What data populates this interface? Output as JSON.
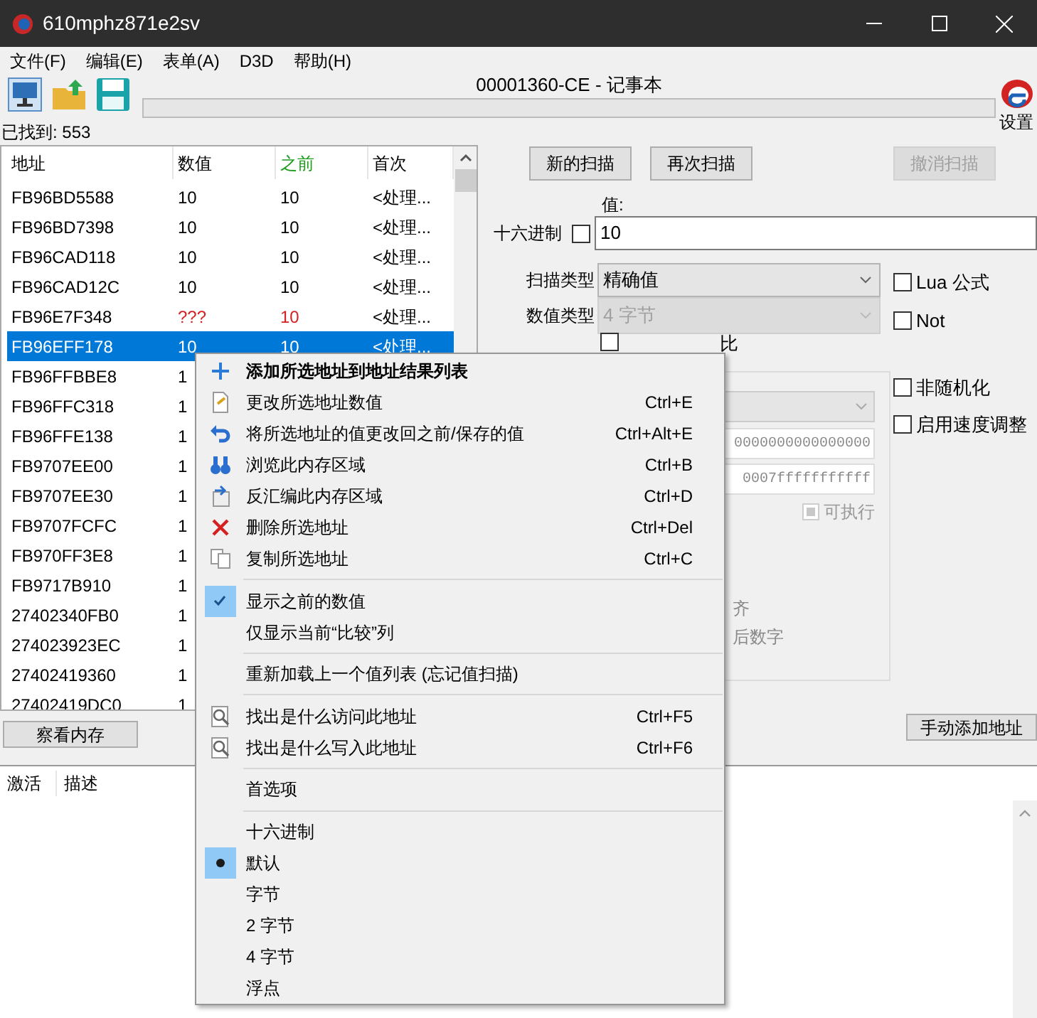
{
  "window": {
    "title": "610mphz871e2sv"
  },
  "menu_bar": [
    "文件(F)",
    "编辑(E)",
    "表单(A)",
    "D3D",
    "帮助(H)"
  ],
  "process_title": "00001360-CE - 记事本",
  "found_label": "已找到: 553",
  "progress": {
    "level": 0
  },
  "settings_label": "设置",
  "results": {
    "columns": [
      {
        "label": "地址"
      },
      {
        "label": "数值"
      },
      {
        "label": "之前",
        "color": "#1e9e1e"
      },
      {
        "label": "首次"
      }
    ],
    "rows": [
      {
        "address": "FB96BD5588",
        "value": "10",
        "previous": "10",
        "first": "<处理...",
        "selected": false,
        "changed": false
      },
      {
        "address": "FB96BD7398",
        "value": "10",
        "previous": "10",
        "first": "<处理...",
        "selected": false,
        "changed": false
      },
      {
        "address": "FB96CAD118",
        "value": "10",
        "previous": "10",
        "first": "<处理...",
        "selected": false,
        "changed": false
      },
      {
        "address": "FB96CAD12C",
        "value": "10",
        "previous": "10",
        "first": "<处理...",
        "selected": false,
        "changed": false
      },
      {
        "address": "FB96E7F348",
        "value": "???",
        "previous": "10",
        "first": "<处理...",
        "selected": false,
        "changed": true
      },
      {
        "address": "FB96EFF178",
        "value": "10",
        "previous": "10",
        "first": "<处理...",
        "selected": true,
        "changed": false
      },
      {
        "address": "FB96FFBBE8",
        "value": "1",
        "selected": false,
        "changed": false
      },
      {
        "address": "FB96FFC318",
        "value": "1",
        "selected": false,
        "changed": false
      },
      {
        "address": "FB96FFE138",
        "value": "1",
        "selected": false,
        "changed": false
      },
      {
        "address": "FB9707EE00",
        "value": "1",
        "selected": false,
        "changed": false
      },
      {
        "address": "FB9707EE30",
        "value": "1",
        "selected": false,
        "changed": false
      },
      {
        "address": "FB9707FCFC",
        "value": "1",
        "selected": false,
        "changed": false
      },
      {
        "address": "FB970FF3E8",
        "value": "1",
        "selected": false,
        "changed": false
      },
      {
        "address": "FB9717B910",
        "value": "1",
        "selected": false,
        "changed": false
      },
      {
        "address": "27402340FB0",
        "value": "1",
        "selected": false,
        "changed": false
      },
      {
        "address": "274023923EC",
        "value": "1",
        "selected": false,
        "changed": false
      },
      {
        "address": "27402419360",
        "value": "1",
        "selected": false,
        "changed": false
      },
      {
        "address": "27402419DC0",
        "value": "1",
        "selected": false,
        "changed": false
      }
    ]
  },
  "scan_buttons": [
    {
      "label": "新的扫描",
      "disabled": false
    },
    {
      "label": "再次扫描",
      "disabled": false
    },
    {
      "label": "撤消扫描",
      "disabled": true
    }
  ],
  "value_field": {
    "label": "值:",
    "value": "10"
  },
  "hex_option": {
    "label": "十六进制",
    "checked": false
  },
  "scan_type": {
    "label": "扫描类型",
    "value": "精确值",
    "disabled": false
  },
  "value_type": {
    "label": "数值类型",
    "value": "4 字节",
    "disabled": true
  },
  "compare_option": {
    "label": "比",
    "checked": false
  },
  "side_options": [
    {
      "label": "Lua 公式",
      "checked": false
    },
    {
      "label": "Not",
      "checked": false
    },
    {
      "label": "非随机化",
      "checked": false
    },
    {
      "label": "启用速度调整",
      "checked": false
    }
  ],
  "memory_options": {
    "start": "0000000000000000",
    "stop": "0007fffffffffff",
    "executable": {
      "label": "可执行",
      "checked": true
    },
    "align_label": "齐",
    "last_digits_label": "后数字"
  },
  "view_memory_button": "察看内存",
  "add_address_button": "手动添加地址",
  "address_list": {
    "columns": [
      "激活",
      "描述"
    ]
  },
  "context_menu": [
    {
      "kind": "item",
      "label": "添加所选地址到地址结果列表",
      "default": true
    },
    {
      "kind": "item",
      "label": "更改所选地址数值",
      "shortcut": "Ctrl+E"
    },
    {
      "kind": "item",
      "label": "将所选地址的值更改回之前/保存的值",
      "shortcut": "Ctrl+Alt+E"
    },
    {
      "kind": "item",
      "label": "浏览此内存区域",
      "shortcut": "Ctrl+B"
    },
    {
      "kind": "item",
      "label": "反汇编此内存区域",
      "shortcut": "Ctrl+D"
    },
    {
      "kind": "item",
      "label": "删除所选地址",
      "shortcut": "Ctrl+Del"
    },
    {
      "kind": "item",
      "label": "复制所选地址",
      "shortcut": "Ctrl+C"
    },
    {
      "kind": "separator"
    },
    {
      "kind": "check",
      "label": "显示之前的数值",
      "checked": true
    },
    {
      "kind": "check",
      "label": "仅显示当前“比较”列",
      "checked": false
    },
    {
      "kind": "separator"
    },
    {
      "kind": "item",
      "label": "重新加载上一个值列表 (忘记值扫描)"
    },
    {
      "kind": "separator"
    },
    {
      "kind": "item",
      "label": "找出是什么访问此地址",
      "shortcut": "Ctrl+F5"
    },
    {
      "kind": "item",
      "label": "找出是什么写入此地址",
      "shortcut": "Ctrl+F6"
    },
    {
      "kind": "separator"
    },
    {
      "kind": "item",
      "label": "首选项"
    },
    {
      "kind": "separator"
    },
    {
      "kind": "radio",
      "label": "十六进制",
      "checked": false
    },
    {
      "kind": "radio",
      "label": "默认",
      "checked": true
    },
    {
      "kind": "radio",
      "label": "字节",
      "checked": false
    },
    {
      "kind": "radio",
      "label": "2 字节",
      "checked": false
    },
    {
      "kind": "radio",
      "label": "4 字节",
      "checked": false
    },
    {
      "kind": "radio",
      "label": "浮点",
      "checked": false
    }
  ]
}
